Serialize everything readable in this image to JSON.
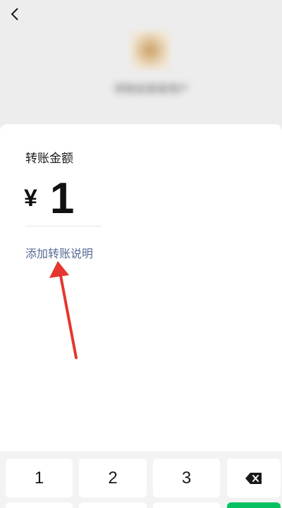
{
  "header": {
    "back_icon": "chevron-left-icon",
    "payee_name": "转账给某某用户"
  },
  "transfer": {
    "amount_label": "转账金额",
    "currency_symbol": "¥",
    "amount": "1",
    "add_note_label": "添加转账说明"
  },
  "annotation": {
    "arrow_color": "#e5372e"
  },
  "keypad": {
    "keys": [
      "1",
      "2",
      "3"
    ],
    "delete_icon": "backspace-icon",
    "confirm_color": "#07c160"
  }
}
